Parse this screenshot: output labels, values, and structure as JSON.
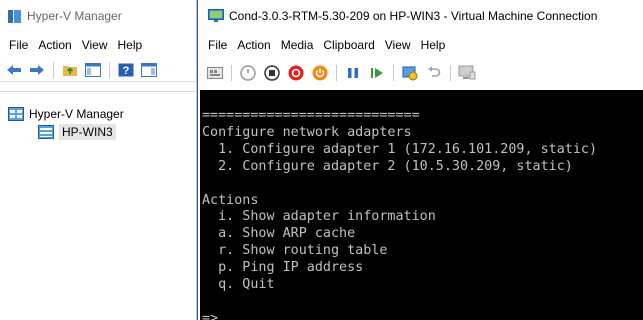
{
  "hyperv": {
    "title": "Hyper-V Manager",
    "menu": [
      "File",
      "Action",
      "View",
      "Help"
    ],
    "toolbar_icons": [
      "back-icon",
      "forward-icon",
      "folder-up-icon",
      "show-hide-tree-icon",
      "help-icon",
      "show-hide-action-pane-icon"
    ],
    "tree": {
      "root": "Hyper-V Manager",
      "child": "HP-WIN3"
    }
  },
  "vm": {
    "title": "Cond-3.0.3-RTM-5.30-209 on HP-WIN3 - Virtual Machine Connection",
    "menu": [
      "File",
      "Action",
      "Media",
      "Clipboard",
      "View",
      "Help"
    ],
    "toolbar_icons": [
      "ctrl-alt-del-icon",
      "start-icon",
      "turn-off-icon",
      "shutdown-icon",
      "power-icon",
      "pause-icon",
      "resume-icon",
      "checkpoint-icon",
      "revert-icon",
      "enhanced-session-icon"
    ],
    "console_lines": [
      "===========================",
      "Configure network adapters",
      "  1. Configure adapter 1 (172.16.101.209, static)",
      "  2. Configure adapter 2 (10.5.30.209, static)",
      "",
      "Actions",
      "  i. Show adapter information",
      "  a. Show ARP cache",
      "  r. Show routing table",
      "  p. Ping IP address",
      "  q. Quit",
      "",
      "=>"
    ]
  },
  "colors": {
    "console_bg": "#000000",
    "console_fg": "#c0c0c0",
    "tree_selection": "#e5e5e5",
    "vm_border": "#1c5fa8"
  }
}
